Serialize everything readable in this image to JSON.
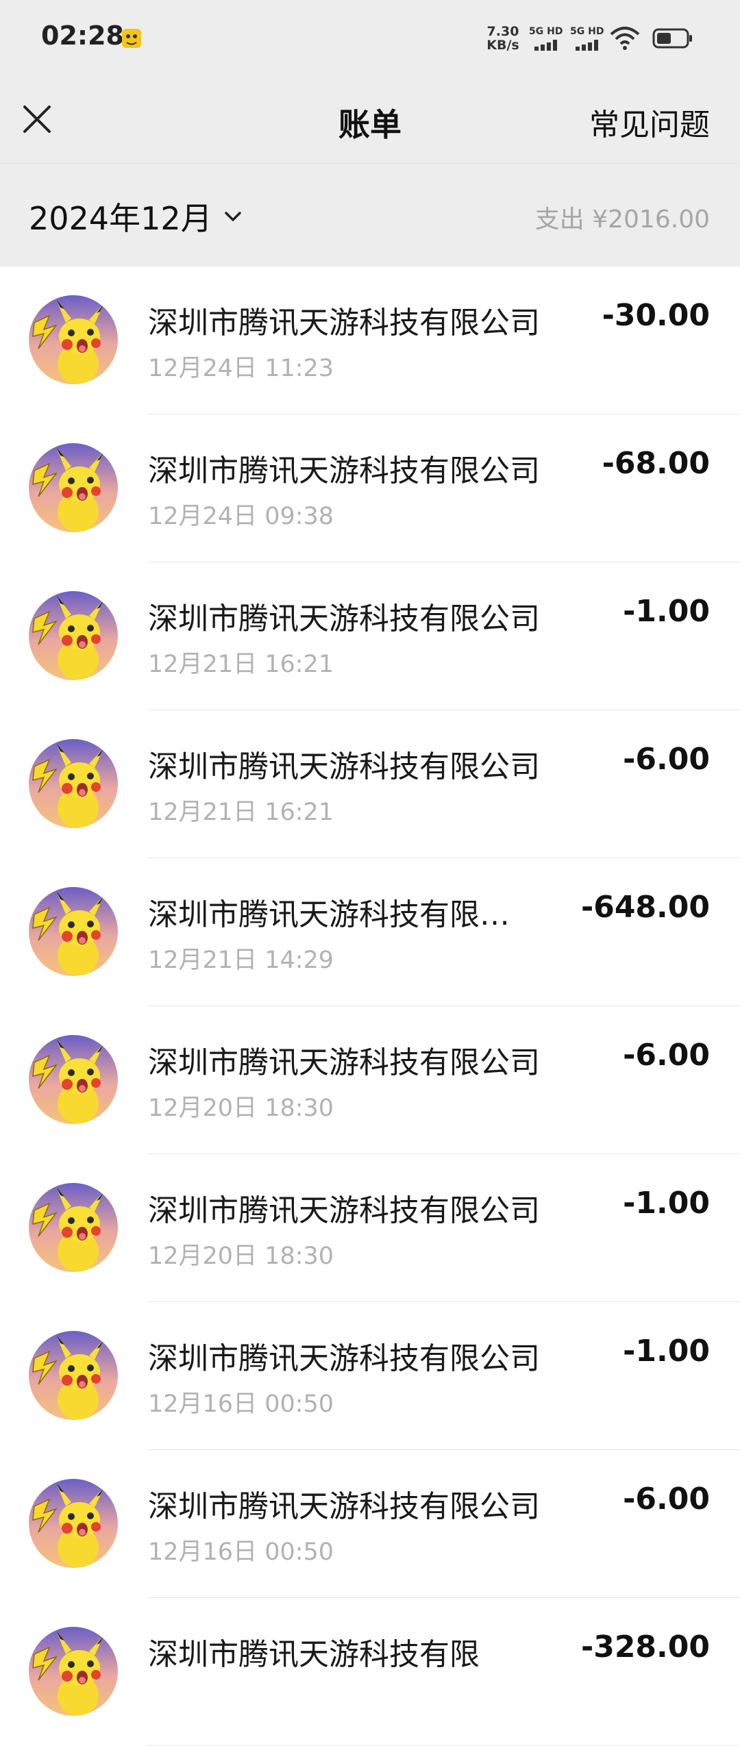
{
  "status_bar": {
    "time": "02:28",
    "net_speed_value": "7.30",
    "net_speed_unit": "KB/s",
    "sim1_label": "5G HD",
    "sim2_label": "5G HD"
  },
  "nav": {
    "title": "账单",
    "faq_label": "常见问题"
  },
  "filter": {
    "month": "2024年12月",
    "summary": "支出 ¥2016.00"
  },
  "transactions": [
    {
      "merchant": "深圳市腾讯天游科技有限公司",
      "time": "12月24日 11:23",
      "amount": "-30.00"
    },
    {
      "merchant": "深圳市腾讯天游科技有限公司",
      "time": "12月24日 09:38",
      "amount": "-68.00"
    },
    {
      "merchant": "深圳市腾讯天游科技有限公司",
      "time": "12月21日 16:21",
      "amount": "-1.00"
    },
    {
      "merchant": "深圳市腾讯天游科技有限公司",
      "time": "12月21日 16:21",
      "amount": "-6.00"
    },
    {
      "merchant": "深圳市腾讯天游科技有限…",
      "time": "12月21日 14:29",
      "amount": "-648.00"
    },
    {
      "merchant": "深圳市腾讯天游科技有限公司",
      "time": "12月20日 18:30",
      "amount": "-6.00"
    },
    {
      "merchant": "深圳市腾讯天游科技有限公司",
      "time": "12月20日 18:30",
      "amount": "-1.00"
    },
    {
      "merchant": "深圳市腾讯天游科技有限公司",
      "time": "12月16日 00:50",
      "amount": "-1.00"
    },
    {
      "merchant": "深圳市腾讯天游科技有限公司",
      "time": "12月16日 00:50",
      "amount": "-6.00"
    },
    {
      "merchant": "深圳市腾讯天游科技有限",
      "time": "",
      "amount": "-328.00"
    }
  ],
  "icons": {
    "close": "close-icon",
    "month_dropdown": "chevron-down-icon",
    "avatar": "pikachu-avatar-icon"
  }
}
